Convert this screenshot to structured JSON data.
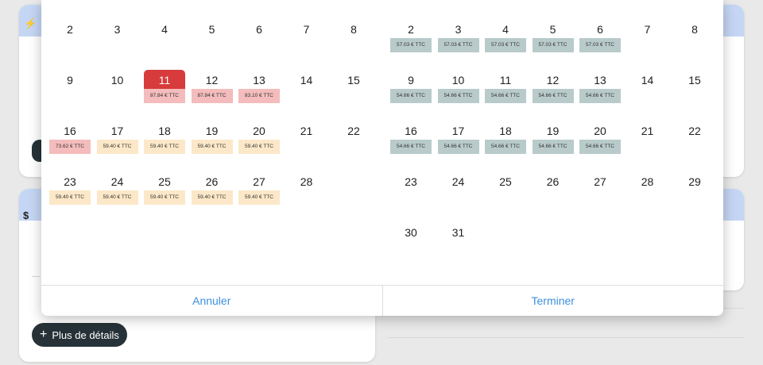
{
  "background": {
    "details_button": {
      "icon": "plus-icon",
      "plus": "+",
      "label": "Plus de détails"
    },
    "card_icons": {
      "top": "⚡",
      "bottom": "$"
    }
  },
  "calendar": {
    "left_month": {
      "rows": [
        [
          {
            "d": "2"
          },
          {
            "d": "3"
          },
          {
            "d": "4"
          },
          {
            "d": "5"
          },
          {
            "d": "6"
          },
          {
            "d": "7"
          },
          {
            "d": "8"
          }
        ],
        [
          {
            "d": "9"
          },
          {
            "d": "10"
          },
          {
            "d": "11",
            "p": "87.84 € TTC",
            "c": "pink",
            "sel": true
          },
          {
            "d": "12",
            "p": "87.84 € TTC",
            "c": "pink"
          },
          {
            "d": "13",
            "p": "83.10 € TTC",
            "c": "pink"
          },
          {
            "d": "14"
          },
          {
            "d": "15"
          }
        ],
        [
          {
            "d": "16",
            "p": "73.62 € TTC",
            "c": "pink"
          },
          {
            "d": "17",
            "p": "59.40 € TTC",
            "c": "yellow"
          },
          {
            "d": "18",
            "p": "59.40 € TTC",
            "c": "yellow"
          },
          {
            "d": "19",
            "p": "59.40 € TTC",
            "c": "yellow"
          },
          {
            "d": "20",
            "p": "59.40 € TTC",
            "c": "yellow"
          },
          {
            "d": "21"
          },
          {
            "d": "22"
          }
        ],
        [
          {
            "d": "23",
            "p": "59.40 € TTC",
            "c": "yellow"
          },
          {
            "d": "24",
            "p": "59.40 € TTC",
            "c": "yellow"
          },
          {
            "d": "25",
            "p": "59.40 € TTC",
            "c": "yellow"
          },
          {
            "d": "26",
            "p": "59.40 € TTC",
            "c": "yellow"
          },
          {
            "d": "27",
            "p": "59.40 € TTC",
            "c": "yellow"
          },
          {
            "d": "28"
          },
          {
            "d": ""
          }
        ]
      ]
    },
    "right_month": {
      "rows": [
        [
          {
            "d": "2",
            "p": "57.03 € TTC",
            "c": "grey"
          },
          {
            "d": "3",
            "p": "57.03 € TTC",
            "c": "grey"
          },
          {
            "d": "4",
            "p": "57.03 € TTC",
            "c": "grey"
          },
          {
            "d": "5",
            "p": "57.03 € TTC",
            "c": "grey"
          },
          {
            "d": "6",
            "p": "57.03 € TTC",
            "c": "grey"
          },
          {
            "d": "7"
          },
          {
            "d": "8"
          }
        ],
        [
          {
            "d": "9",
            "p": "54.66 € TTC",
            "c": "grey"
          },
          {
            "d": "10",
            "p": "54.66 € TTC",
            "c": "grey"
          },
          {
            "d": "11",
            "p": "54.66 € TTC",
            "c": "grey"
          },
          {
            "d": "12",
            "p": "54.66 € TTC",
            "c": "grey"
          },
          {
            "d": "13",
            "p": "54.66 € TTC",
            "c": "grey"
          },
          {
            "d": "14"
          },
          {
            "d": "15"
          }
        ],
        [
          {
            "d": "16",
            "p": "54.66 € TTC",
            "c": "grey"
          },
          {
            "d": "17",
            "p": "54.66 € TTC",
            "c": "grey"
          },
          {
            "d": "18",
            "p": "54.66 € TTC",
            "c": "grey"
          },
          {
            "d": "19",
            "p": "54.66 € TTC",
            "c": "grey"
          },
          {
            "d": "20",
            "p": "54.66 € TTC",
            "c": "grey"
          },
          {
            "d": "21"
          },
          {
            "d": "22"
          }
        ],
        [
          {
            "d": "23"
          },
          {
            "d": "24"
          },
          {
            "d": "25"
          },
          {
            "d": "26"
          },
          {
            "d": "27"
          },
          {
            "d": "28"
          },
          {
            "d": "29"
          }
        ],
        [
          {
            "d": "30"
          },
          {
            "d": "31"
          },
          {
            "d": ""
          },
          {
            "d": ""
          },
          {
            "d": ""
          },
          {
            "d": ""
          },
          {
            "d": ""
          }
        ]
      ]
    },
    "colors": {
      "selected": "#d73b3b",
      "pink": "#f4bcbc",
      "yellow": "#fce8c8",
      "grey": "#b8cbca"
    }
  },
  "footer": {
    "cancel_label": "Annuler",
    "confirm_label": "Terminer"
  }
}
